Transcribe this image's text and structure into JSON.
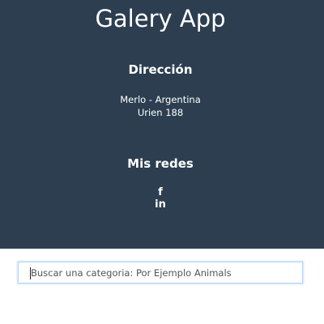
{
  "header": {
    "app_title": "Galery App"
  },
  "address": {
    "heading": "Dirección",
    "line1": "Merlo - Argentina",
    "line2": "Urien 188"
  },
  "social": {
    "heading": "Mis redes",
    "facebook_glyph": "f",
    "linkedin_glyph": "in",
    "facebook_icon": "facebook-icon",
    "linkedin_icon": "linkedin-icon"
  },
  "search": {
    "placeholder": "Buscar una categoria: Por Ejemplo Animals",
    "value": ""
  },
  "colors": {
    "footer_background": "#2c3e50",
    "text": "#ffffff",
    "input_focus_border": "#b9d3f2"
  }
}
